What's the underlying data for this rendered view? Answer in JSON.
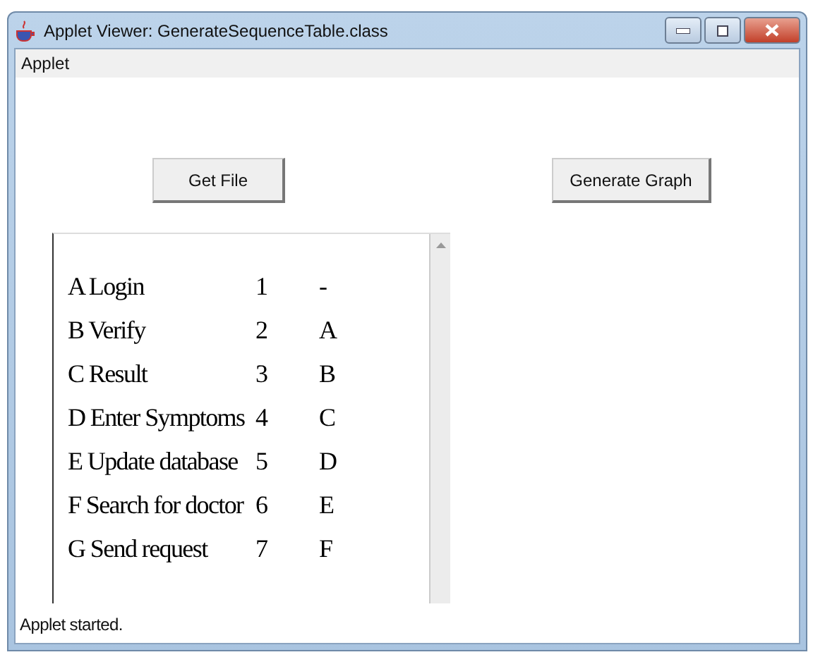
{
  "window": {
    "title": "Applet Viewer: GenerateSequenceTable.class"
  },
  "menu": [
    "Applet"
  ],
  "buttons": [
    "Get File",
    "Generate Graph"
  ],
  "table_rows": [
    {
      "column_1": "A Login",
      "column_2": "1",
      "column_3": "-"
    },
    {
      "column_1": "B Verify",
      "column_2": "2",
      "column_3": "A"
    },
    {
      "column_1": "C Result",
      "column_2": "3",
      "column_3": "B"
    },
    {
      "column_1": "D Enter Symptoms",
      "column_2": "4",
      "column_3": "C"
    },
    {
      "column_1": "E Update database",
      "column_2": "5",
      "column_3": "D"
    },
    {
      "column_1": "F Search for doctor",
      "column_2": "6",
      "column_3": "E"
    },
    {
      "column_1": "G Send request",
      "column_2": "7",
      "column_3": "F"
    }
  ],
  "status_bar": "Applet started."
}
